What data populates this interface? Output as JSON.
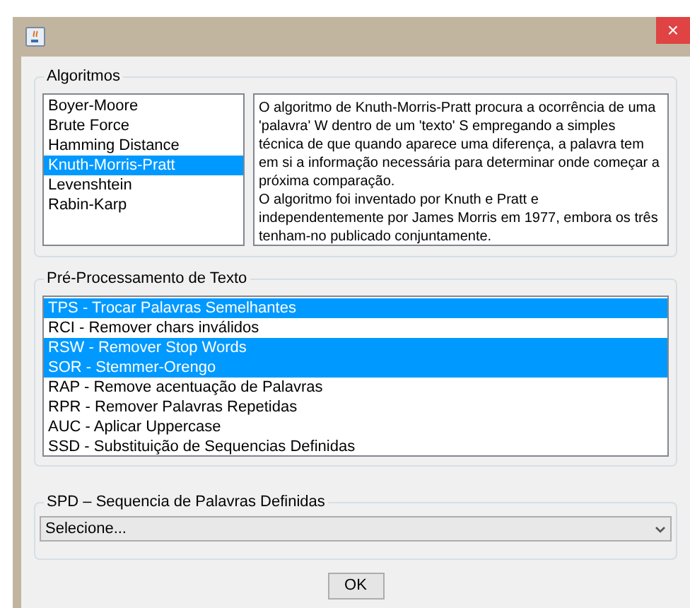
{
  "window": {
    "close": "×"
  },
  "algorithms": {
    "title": "Algoritmos",
    "items": [
      {
        "label": "Boyer-Moore",
        "selected": false
      },
      {
        "label": "Brute Force",
        "selected": false
      },
      {
        "label": "Hamming Distance",
        "selected": false
      },
      {
        "label": "Knuth-Morris-Pratt",
        "selected": true
      },
      {
        "label": "Levenshtein",
        "selected": false
      },
      {
        "label": "Rabin-Karp",
        "selected": false
      }
    ],
    "description": [
      "O algoritmo de Knuth-Morris-Pratt procura a ocorrência de uma 'palavra' W dentro de um 'texto' S empregando a simples técnica de que quando aparece uma diferença, a palavra tem em si a informação necessária para determinar onde começar a próxima comparação.",
      "O algoritmo foi inventado por Knuth e Pratt e independentemente por James Morris em 1977, embora os três tenham-no publicado conjuntamente."
    ]
  },
  "preprocessing": {
    "title": "Pré-Processamento de Texto",
    "items": [
      {
        "label": "TPS - Trocar Palavras Semelhantes",
        "selected": true
      },
      {
        "label": "RCI - Remover chars inválidos",
        "selected": false
      },
      {
        "label": "RSW - Remover Stop Words",
        "selected": true
      },
      {
        "label": "SOR - Stemmer-Orengo",
        "selected": true
      },
      {
        "label": "RAP - Remove acentuação de Palavras",
        "selected": false
      },
      {
        "label": "RPR - Remover Palavras Repetidas",
        "selected": false
      },
      {
        "label": "AUC - Aplicar Uppercase",
        "selected": false
      },
      {
        "label": "SSD - Substituição de Sequencias Definidas",
        "selected": false
      }
    ]
  },
  "spd": {
    "title": "SPD – Sequencia de Palavras Definidas",
    "value": "Selecione..."
  },
  "buttons": [
    "OK"
  ]
}
